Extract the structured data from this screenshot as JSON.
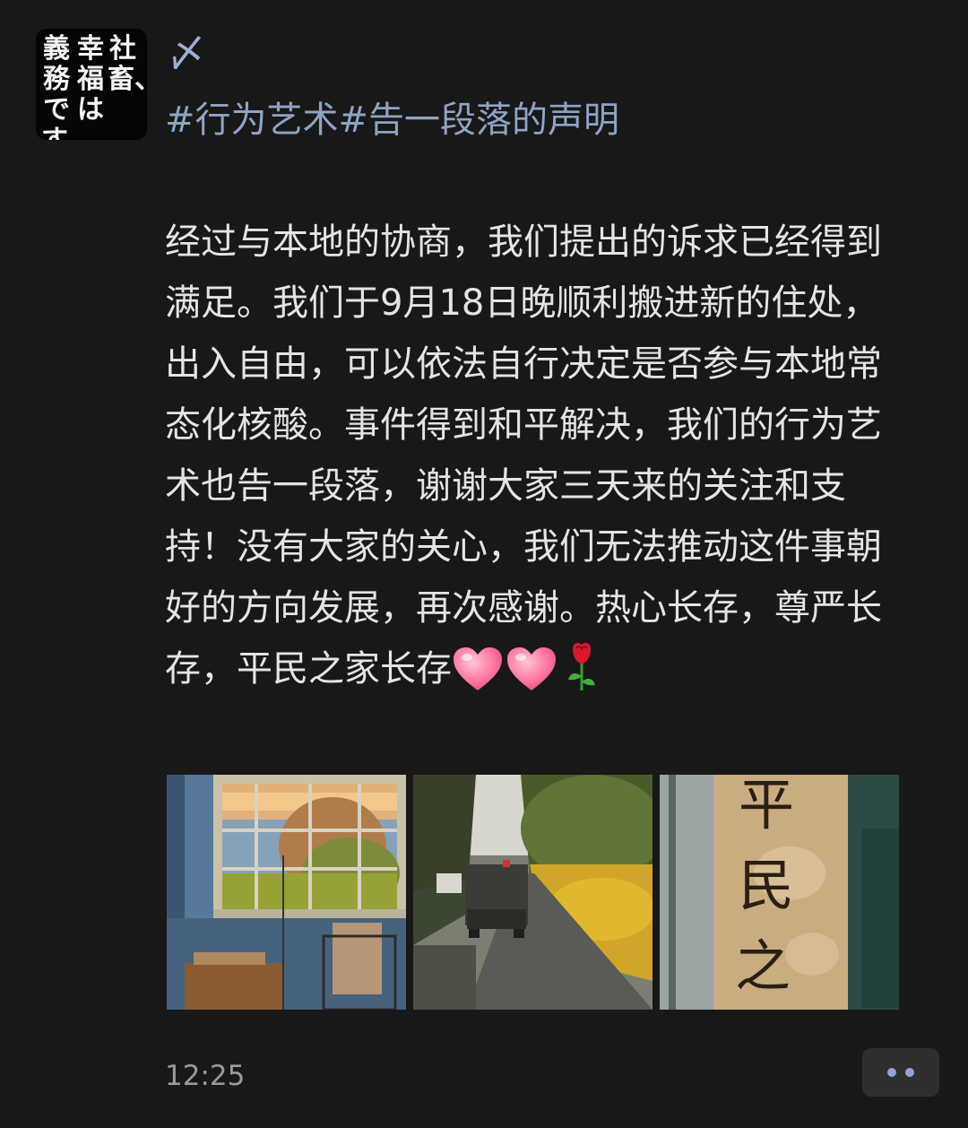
{
  "post": {
    "avatar_text": {
      "col1": "社畜、",
      "col2": "幸福は",
      "col3": "義務です。"
    },
    "username": "〆",
    "topics": {
      "tag1": "#行为艺术",
      "tag2": "#告一段落的声明"
    },
    "body": "经过与本地的协商，我们提出的诉求已经得到满足。我们于9月18日晚顺利搬进新的住处，出入自由，可以依法自行决定是否参与本地常态化核酸。事件得到和平解决，我们的行为艺术也告一段落，谢谢大家三天来的关注和支持！没有大家的关心，我们无法推动这件事朝好的方向发展，再次感谢。热心长存，尊严长存，平民之家长存",
    "emojis": [
      "heart-emoji",
      "heart-emoji",
      "rose-emoji"
    ],
    "photos": [
      {
        "name": "room-window-photo"
      },
      {
        "name": "road-truck-photo"
      },
      {
        "name": "calligraphy-banner-photo"
      }
    ],
    "banner_chars": [
      "平",
      "民",
      "之"
    ],
    "time": "12:25",
    "more_icon": "more-dots-icon"
  },
  "colors": {
    "background": "#181818",
    "topic": "#8ea4c4",
    "username": "#9bb0d2",
    "body_text": "#e4e4e4",
    "time": "#9a9a9a",
    "accent_dots": "#8fa7cf"
  }
}
